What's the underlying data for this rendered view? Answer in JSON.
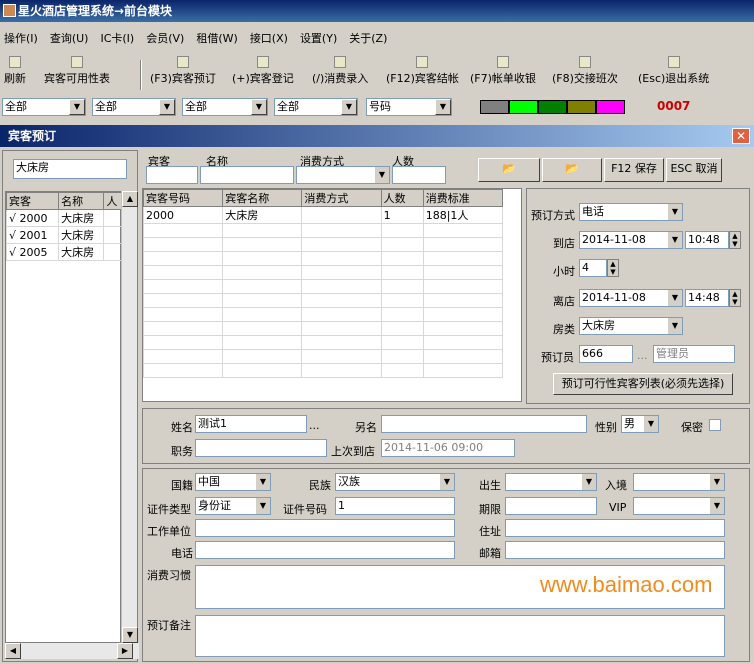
{
  "app_title": "星火酒店管理系统→前台模块",
  "menu": [
    "操作(I)",
    "查询(U)",
    "IC卡(I)",
    "会员(V)",
    "租借(W)",
    "接口(X)",
    "设置(Y)",
    "关于(Z)"
  ],
  "toolbar": [
    "刷新",
    "宾客可用性表",
    "(F3)宾客预订",
    "(+)宾客登记",
    "(/)消费录入",
    "(F12)宾客结帐",
    "(F7)帐单收银",
    "(F8)交接班次",
    "(Esc)退出系统"
  ],
  "filters": [
    "全部",
    "全部",
    "全部",
    "全部",
    "号码"
  ],
  "swatches": [
    "#808080",
    "#00ff00",
    "#008000",
    "#808000",
    "#ff00ff"
  ],
  "counter": "0007",
  "dialog_title": "宾客预订",
  "room_search": "大床房",
  "left_table": {
    "headers": [
      "宾客",
      "名称",
      "人"
    ],
    "rows": [
      [
        "√ 2000",
        "大床房",
        ""
      ],
      [
        "√ 2001",
        "大床房",
        ""
      ],
      [
        "√ 2005",
        "大床房",
        ""
      ]
    ]
  },
  "top_form": {
    "l1": "宾客",
    "l2": "名称",
    "l3": "消费方式",
    "l4": "人数",
    "save": "F12 保存",
    "cancel": "ESC 取消"
  },
  "main_table": {
    "headers": [
      "宾客号码",
      "宾客名称",
      "消费方式",
      "人数",
      "消费标准"
    ],
    "rows": [
      [
        "2000",
        "大床房",
        "",
        "1",
        "188|1人"
      ]
    ]
  },
  "booking": {
    "method_label": "预订方式",
    "method": "电话",
    "arrive_label": "到店",
    "arrive_date": "2014-11-08",
    "arrive_time": "10:48",
    "hours_label": "小时",
    "hours": "4",
    "leave_label": "离店",
    "leave_date": "2014-11-08",
    "leave_time": "14:48",
    "room_type_label": "房类",
    "room_type": "大床房",
    "booker_label": "预订员",
    "booker_id": "666",
    "booker_name": "管理员",
    "list_button": "预订可行性宾客列表(必须先选择)"
  },
  "guest": {
    "name_label": "姓名",
    "name": "测试1",
    "alias_label": "另名",
    "gender_label": "性别",
    "gender": "男",
    "secret_label": "保密",
    "title_label": "职务",
    "last_label": "上次到店",
    "last": "2014-11-06 09:00"
  },
  "detail": {
    "nation_label": "国籍",
    "nation": "中国",
    "ethnic_label": "民族",
    "ethnic": "汉族",
    "birth_label": "出生",
    "entry_label": "入境",
    "idtype_label": "证件类型",
    "idtype": "身份证",
    "idno_label": "证件号码",
    "idno": "1",
    "expire_label": "期限",
    "vip_label": "VIP",
    "work_label": "工作单位",
    "addr_label": "住址",
    "phone_label": "电话",
    "email_label": "邮箱",
    "habit_label": "消费习惯",
    "remark_label": "预订备注"
  },
  "watermark": "www.baimao.com"
}
